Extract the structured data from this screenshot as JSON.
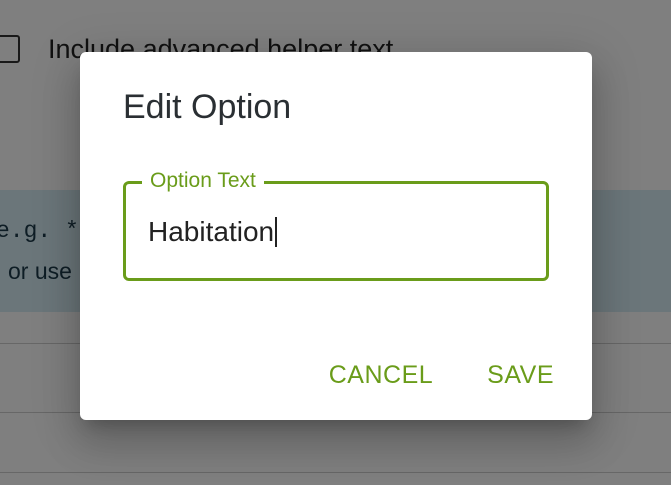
{
  "background": {
    "checkbox_label": "Include advanced helper text",
    "info_line_1": "e.g. **b",
    "info_line_2": "or use"
  },
  "dialog": {
    "title": "Edit Option",
    "field": {
      "label": "Option Text",
      "value": "Habitation"
    },
    "cancel_label": "CANCEL",
    "save_label": "SAVE"
  },
  "colors": {
    "accent": "#6a9c1a",
    "scrim": "rgba(0,0,0,0.5)",
    "info_panel": "#d6ecf4"
  }
}
